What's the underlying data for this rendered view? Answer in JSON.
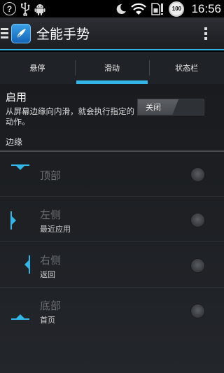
{
  "status_bar": {
    "time": "16:56",
    "battery_level": "100",
    "icons": [
      "help-circle-icon",
      "usb-icon",
      "android-icon",
      "moon-icon",
      "wifi-icon",
      "sim-icon",
      "battery-icon"
    ]
  },
  "action_bar": {
    "title": "全能手势",
    "icons": [
      "drawer-icon",
      "app-logo-icon",
      "overflow-menu-icon"
    ]
  },
  "tabs": [
    {
      "label": "悬停",
      "active": false
    },
    {
      "label": "滑动",
      "active": true
    },
    {
      "label": "状态栏",
      "active": false
    }
  ],
  "enable": {
    "title": "启用",
    "description": "从屏幕边缘向内滑，就会执行指定的动作。",
    "toggle_label": "关闭",
    "toggle_on": false
  },
  "edges": {
    "section_label": "边缘",
    "items": [
      {
        "title": "顶部",
        "subtitle": "",
        "selected": false,
        "icon": "edge-top-icon"
      },
      {
        "title": "左侧",
        "subtitle": "最近应用",
        "selected": false,
        "icon": "edge-left-icon"
      },
      {
        "title": "右侧",
        "subtitle": "返回",
        "selected": false,
        "icon": "edge-right-icon"
      },
      {
        "title": "底部",
        "subtitle": "首页",
        "selected": false,
        "icon": "edge-bottom-icon"
      }
    ]
  },
  "colors": {
    "accent": "#33b5e5",
    "background": "#1c1e22",
    "disabled_text": "#6a6d71"
  }
}
